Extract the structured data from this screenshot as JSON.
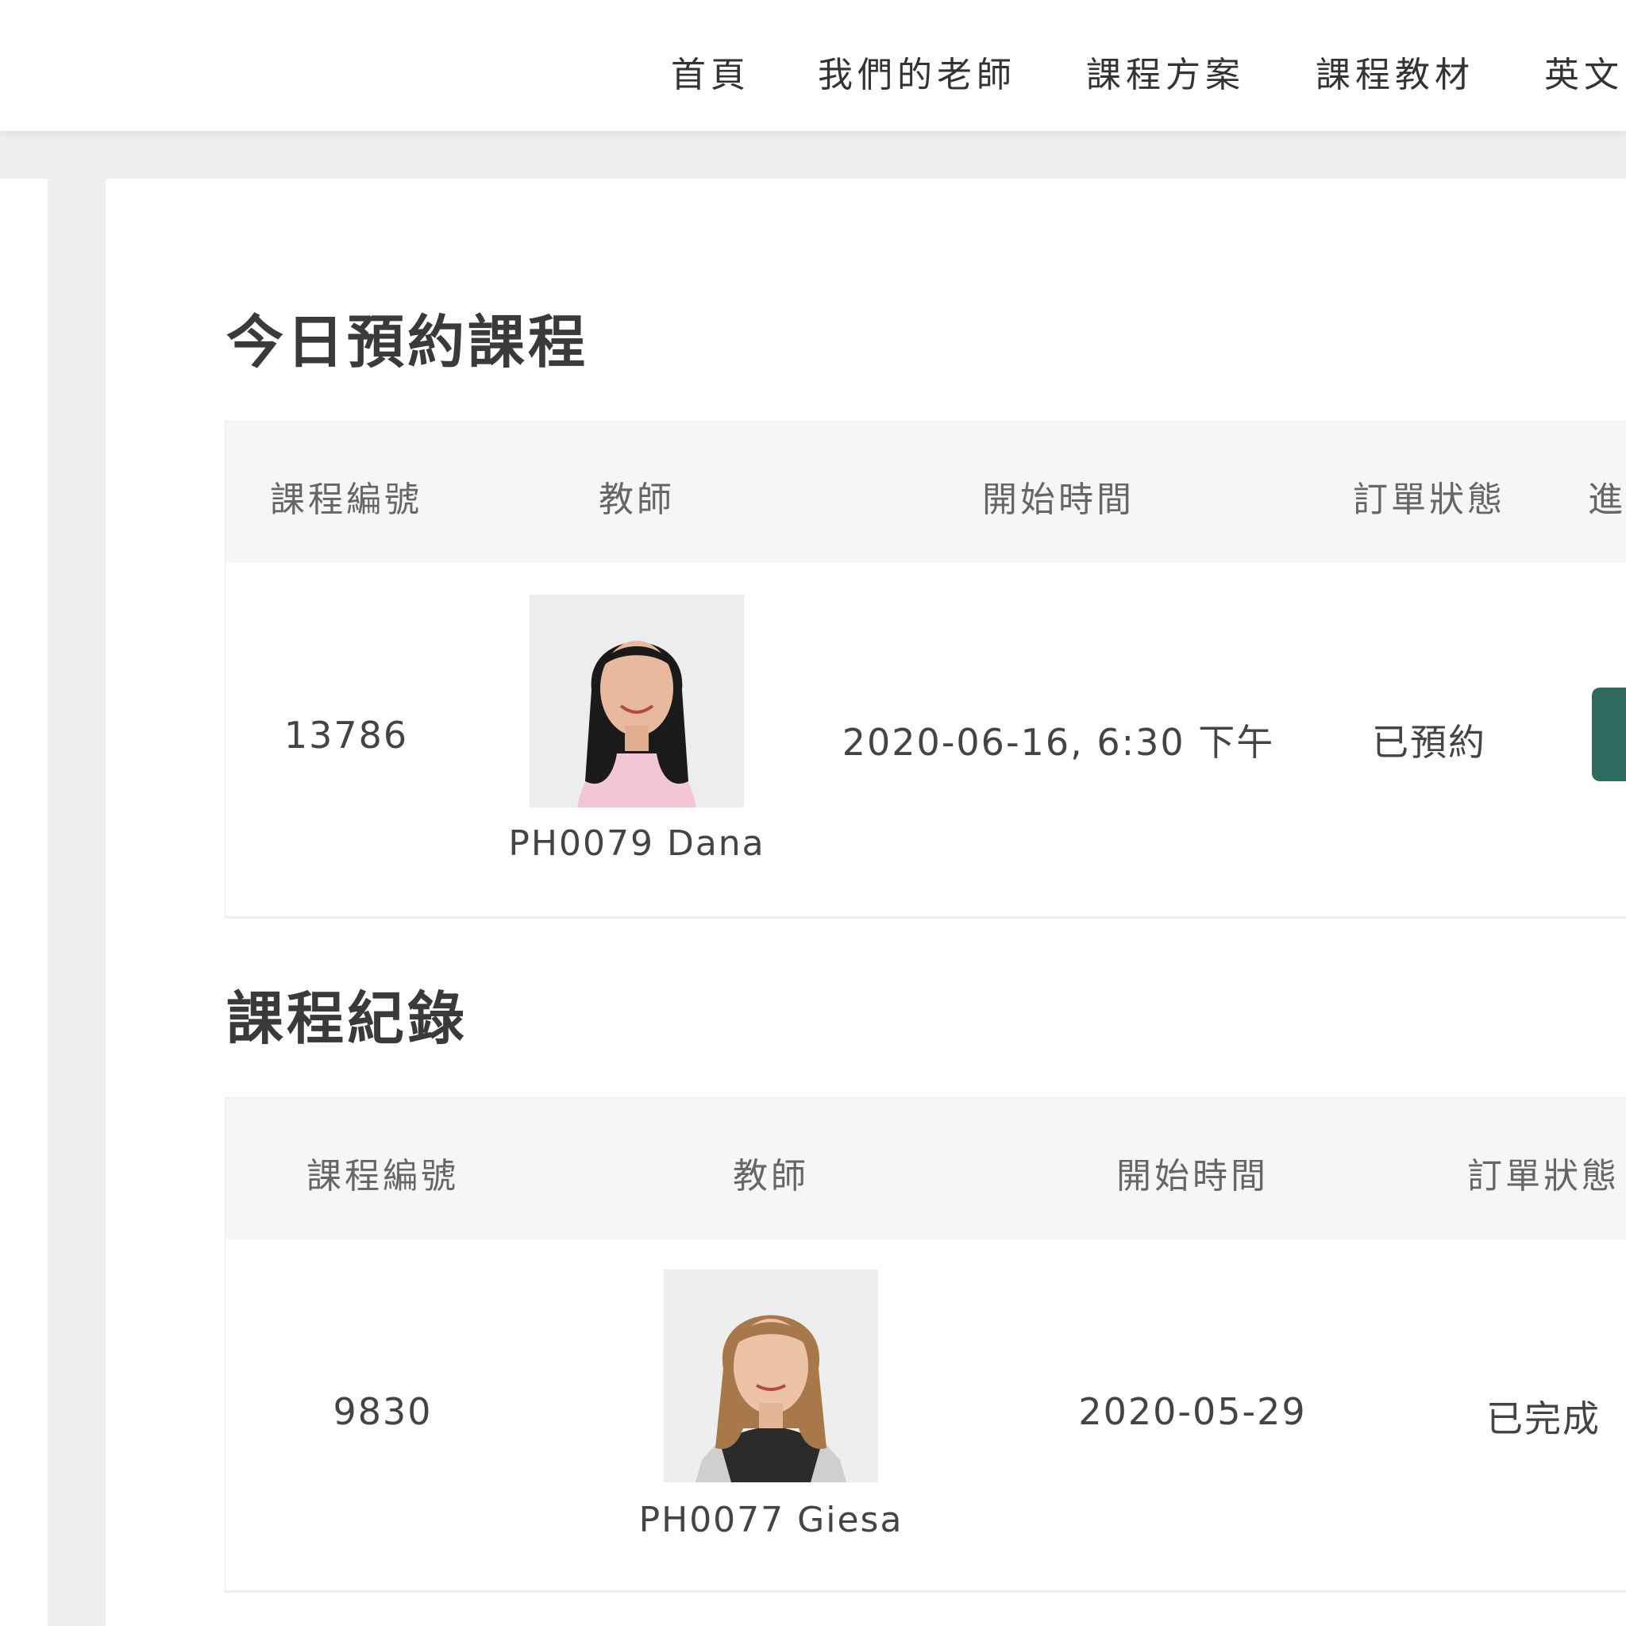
{
  "nav": {
    "items": [
      {
        "label": "首頁"
      },
      {
        "label": "我們的老師"
      },
      {
        "label": "課程方案"
      },
      {
        "label": "課程教材"
      },
      {
        "label": "英文"
      }
    ]
  },
  "today": {
    "title": "今日預約課程",
    "headers": [
      "課程編號",
      "教師",
      "開始時間",
      "訂單狀態",
      "進"
    ],
    "rows": [
      {
        "course_id": "13786",
        "teacher": "PH0079 Dana",
        "start_time": "2020-06-16, 6:30 下午",
        "status": "已預約"
      }
    ]
  },
  "history": {
    "title": "課程紀錄",
    "headers": [
      "課程編號",
      "教師",
      "開始時間",
      "訂單狀態"
    ],
    "rows": [
      {
        "course_id": "9830",
        "teacher": "PH0077 Giesa",
        "start_time": "2020-05-29",
        "status": "已完成"
      }
    ]
  },
  "colors": {
    "accent": "#2f6a5f",
    "header_bg": "#f6f6f6",
    "page_bg": "#efefef"
  }
}
